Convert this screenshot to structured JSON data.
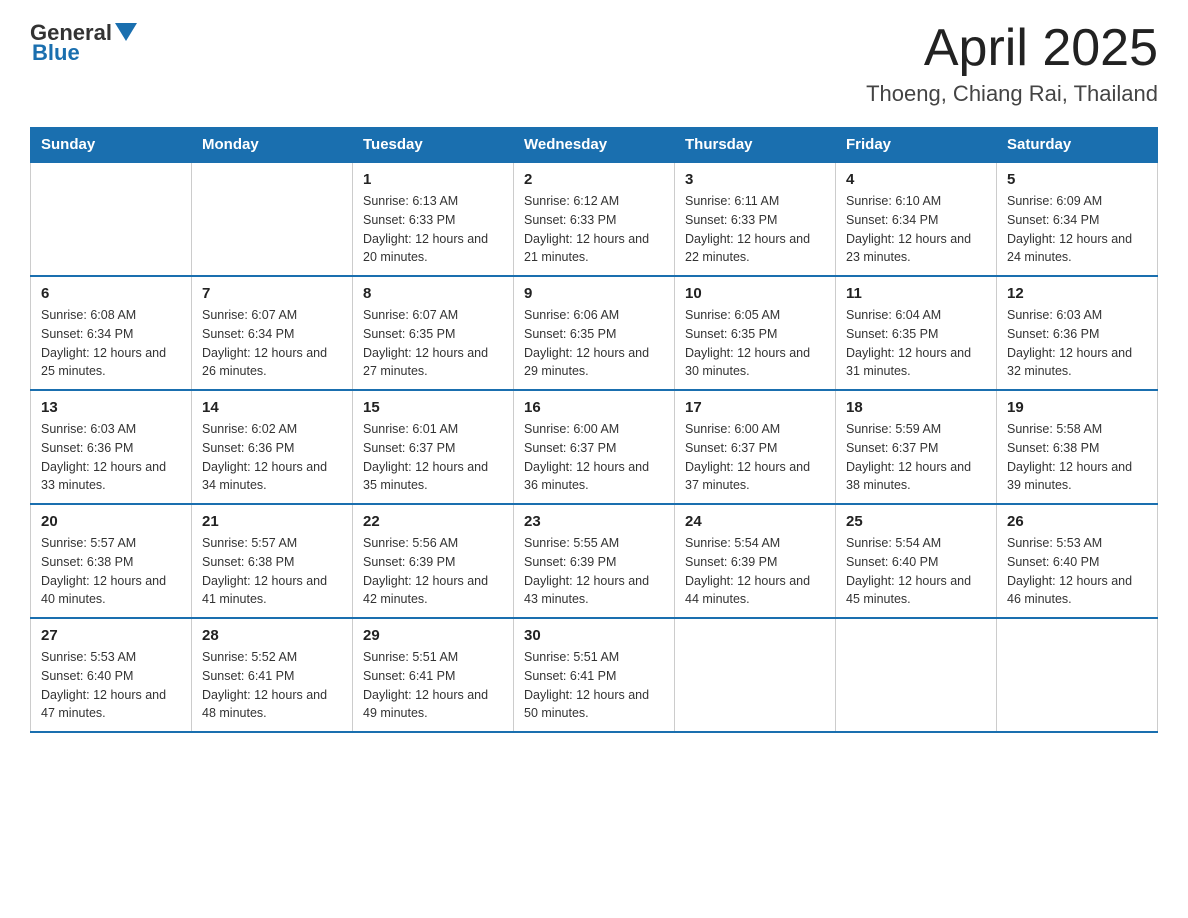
{
  "header": {
    "logo_general": "General",
    "logo_blue": "Blue",
    "main_title": "April 2025",
    "subtitle": "Thoeng, Chiang Rai, Thailand"
  },
  "days_of_week": [
    "Sunday",
    "Monday",
    "Tuesday",
    "Wednesday",
    "Thursday",
    "Friday",
    "Saturday"
  ],
  "weeks": [
    [
      {
        "day": "",
        "sunrise": "",
        "sunset": "",
        "daylight": ""
      },
      {
        "day": "",
        "sunrise": "",
        "sunset": "",
        "daylight": ""
      },
      {
        "day": "1",
        "sunrise": "Sunrise: 6:13 AM",
        "sunset": "Sunset: 6:33 PM",
        "daylight": "Daylight: 12 hours and 20 minutes."
      },
      {
        "day": "2",
        "sunrise": "Sunrise: 6:12 AM",
        "sunset": "Sunset: 6:33 PM",
        "daylight": "Daylight: 12 hours and 21 minutes."
      },
      {
        "day": "3",
        "sunrise": "Sunrise: 6:11 AM",
        "sunset": "Sunset: 6:33 PM",
        "daylight": "Daylight: 12 hours and 22 minutes."
      },
      {
        "day": "4",
        "sunrise": "Sunrise: 6:10 AM",
        "sunset": "Sunset: 6:34 PM",
        "daylight": "Daylight: 12 hours and 23 minutes."
      },
      {
        "day": "5",
        "sunrise": "Sunrise: 6:09 AM",
        "sunset": "Sunset: 6:34 PM",
        "daylight": "Daylight: 12 hours and 24 minutes."
      }
    ],
    [
      {
        "day": "6",
        "sunrise": "Sunrise: 6:08 AM",
        "sunset": "Sunset: 6:34 PM",
        "daylight": "Daylight: 12 hours and 25 minutes."
      },
      {
        "day": "7",
        "sunrise": "Sunrise: 6:07 AM",
        "sunset": "Sunset: 6:34 PM",
        "daylight": "Daylight: 12 hours and 26 minutes."
      },
      {
        "day": "8",
        "sunrise": "Sunrise: 6:07 AM",
        "sunset": "Sunset: 6:35 PM",
        "daylight": "Daylight: 12 hours and 27 minutes."
      },
      {
        "day": "9",
        "sunrise": "Sunrise: 6:06 AM",
        "sunset": "Sunset: 6:35 PM",
        "daylight": "Daylight: 12 hours and 29 minutes."
      },
      {
        "day": "10",
        "sunrise": "Sunrise: 6:05 AM",
        "sunset": "Sunset: 6:35 PM",
        "daylight": "Daylight: 12 hours and 30 minutes."
      },
      {
        "day": "11",
        "sunrise": "Sunrise: 6:04 AM",
        "sunset": "Sunset: 6:35 PM",
        "daylight": "Daylight: 12 hours and 31 minutes."
      },
      {
        "day": "12",
        "sunrise": "Sunrise: 6:03 AM",
        "sunset": "Sunset: 6:36 PM",
        "daylight": "Daylight: 12 hours and 32 minutes."
      }
    ],
    [
      {
        "day": "13",
        "sunrise": "Sunrise: 6:03 AM",
        "sunset": "Sunset: 6:36 PM",
        "daylight": "Daylight: 12 hours and 33 minutes."
      },
      {
        "day": "14",
        "sunrise": "Sunrise: 6:02 AM",
        "sunset": "Sunset: 6:36 PM",
        "daylight": "Daylight: 12 hours and 34 minutes."
      },
      {
        "day": "15",
        "sunrise": "Sunrise: 6:01 AM",
        "sunset": "Sunset: 6:37 PM",
        "daylight": "Daylight: 12 hours and 35 minutes."
      },
      {
        "day": "16",
        "sunrise": "Sunrise: 6:00 AM",
        "sunset": "Sunset: 6:37 PM",
        "daylight": "Daylight: 12 hours and 36 minutes."
      },
      {
        "day": "17",
        "sunrise": "Sunrise: 6:00 AM",
        "sunset": "Sunset: 6:37 PM",
        "daylight": "Daylight: 12 hours and 37 minutes."
      },
      {
        "day": "18",
        "sunrise": "Sunrise: 5:59 AM",
        "sunset": "Sunset: 6:37 PM",
        "daylight": "Daylight: 12 hours and 38 minutes."
      },
      {
        "day": "19",
        "sunrise": "Sunrise: 5:58 AM",
        "sunset": "Sunset: 6:38 PM",
        "daylight": "Daylight: 12 hours and 39 minutes."
      }
    ],
    [
      {
        "day": "20",
        "sunrise": "Sunrise: 5:57 AM",
        "sunset": "Sunset: 6:38 PM",
        "daylight": "Daylight: 12 hours and 40 minutes."
      },
      {
        "day": "21",
        "sunrise": "Sunrise: 5:57 AM",
        "sunset": "Sunset: 6:38 PM",
        "daylight": "Daylight: 12 hours and 41 minutes."
      },
      {
        "day": "22",
        "sunrise": "Sunrise: 5:56 AM",
        "sunset": "Sunset: 6:39 PM",
        "daylight": "Daylight: 12 hours and 42 minutes."
      },
      {
        "day": "23",
        "sunrise": "Sunrise: 5:55 AM",
        "sunset": "Sunset: 6:39 PM",
        "daylight": "Daylight: 12 hours and 43 minutes."
      },
      {
        "day": "24",
        "sunrise": "Sunrise: 5:54 AM",
        "sunset": "Sunset: 6:39 PM",
        "daylight": "Daylight: 12 hours and 44 minutes."
      },
      {
        "day": "25",
        "sunrise": "Sunrise: 5:54 AM",
        "sunset": "Sunset: 6:40 PM",
        "daylight": "Daylight: 12 hours and 45 minutes."
      },
      {
        "day": "26",
        "sunrise": "Sunrise: 5:53 AM",
        "sunset": "Sunset: 6:40 PM",
        "daylight": "Daylight: 12 hours and 46 minutes."
      }
    ],
    [
      {
        "day": "27",
        "sunrise": "Sunrise: 5:53 AM",
        "sunset": "Sunset: 6:40 PM",
        "daylight": "Daylight: 12 hours and 47 minutes."
      },
      {
        "day": "28",
        "sunrise": "Sunrise: 5:52 AM",
        "sunset": "Sunset: 6:41 PM",
        "daylight": "Daylight: 12 hours and 48 minutes."
      },
      {
        "day": "29",
        "sunrise": "Sunrise: 5:51 AM",
        "sunset": "Sunset: 6:41 PM",
        "daylight": "Daylight: 12 hours and 49 minutes."
      },
      {
        "day": "30",
        "sunrise": "Sunrise: 5:51 AM",
        "sunset": "Sunset: 6:41 PM",
        "daylight": "Daylight: 12 hours and 50 minutes."
      },
      {
        "day": "",
        "sunrise": "",
        "sunset": "",
        "daylight": ""
      },
      {
        "day": "",
        "sunrise": "",
        "sunset": "",
        "daylight": ""
      },
      {
        "day": "",
        "sunrise": "",
        "sunset": "",
        "daylight": ""
      }
    ]
  ]
}
